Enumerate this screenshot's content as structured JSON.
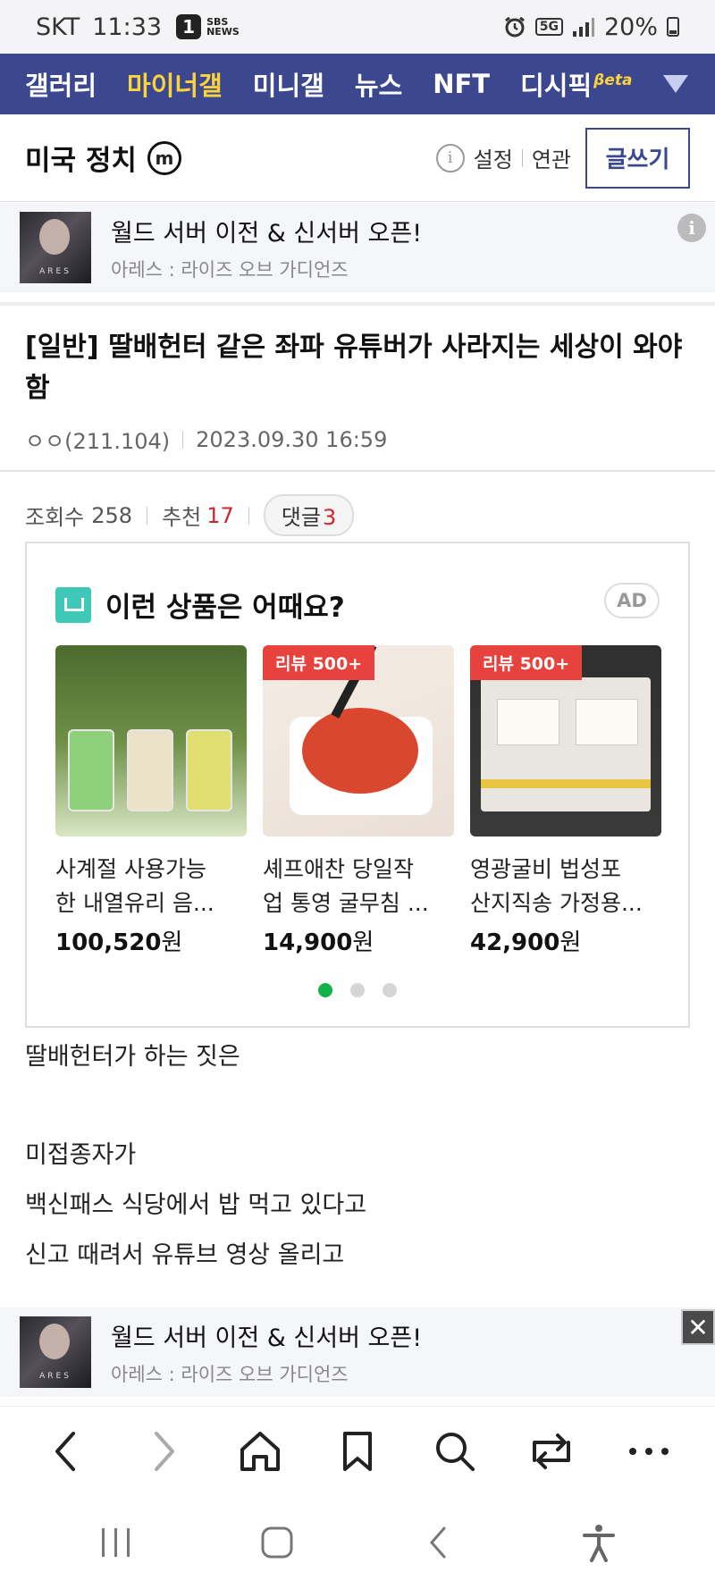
{
  "status_bar": {
    "carrier": "SKT",
    "time": "11:33",
    "notif_badge": "1",
    "sbs_line1": "SBS",
    "sbs_line2": "NEWS",
    "network": "5G",
    "battery": "20%"
  },
  "gallery_nav": {
    "tabs": [
      "갤러리",
      "마이너갤",
      "미니갤",
      "뉴스",
      "NFT",
      "디시픽"
    ],
    "active_index": 1,
    "beta_label": "βeta"
  },
  "board": {
    "title": "미국 정치",
    "minor_mark": "m",
    "links": [
      "설정",
      "연관"
    ],
    "write_button": "글쓰기"
  },
  "top_ad": {
    "title": "월드 서버 이전 & 신서버 오픈!",
    "subtitle": "아레스 : 라이즈 오브 가디언즈",
    "thumb_text": "ARES"
  },
  "post": {
    "title": "[일반] 딸배헌터 같은 좌파 유튜버가 사라지는 세상이 와야함",
    "author": "ㅇㅇ(211.104)",
    "date": "2023.09.30 16:59"
  },
  "stats": {
    "views_label": "조회수",
    "views": "258",
    "recommend_label": "추천",
    "recommend": "17",
    "comments_label": "댓글",
    "comments": "3"
  },
  "product_ad": {
    "heading": "이런 상품은 어때요?",
    "ad_label": "AD",
    "products": [
      {
        "line1": "사계절 사용가능",
        "line2": "한 내열유리 음...",
        "price": "100,520",
        "unit": "원",
        "badge": ""
      },
      {
        "line1": "셰프애찬 당일작",
        "line2": "업 통영 굴무침 ...",
        "price": "14,900",
        "unit": "원",
        "badge": "리뷰 500+"
      },
      {
        "line1": "영광굴비 법성포",
        "line2": "산지직송 가정용...",
        "price": "42,900",
        "unit": "원",
        "badge": "리뷰 500+"
      }
    ],
    "page_count": 3,
    "active_page": 0
  },
  "body_lines": [
    "딸배헌터가 하는 짓은",
    "미접종자가",
    "백신패스 식당에서 밥 먹고 있다고",
    "신고 때려서 유튜브 영상 올리고"
  ],
  "bottom_ad": {
    "title": "월드 서버 이전 & 신서버 오픈!",
    "subtitle": "아레스 : 라이즈 오브 가디언즈",
    "thumb_text": "ARES"
  },
  "colors": {
    "nav_bg": "#3b4890",
    "nav_active": "#fdd33b",
    "accent_red": "#d0262b",
    "badge_red": "#e8423e",
    "dot_active": "#14b04a"
  },
  "icons": {
    "browser_bar": [
      "back-icon",
      "forward-icon",
      "home-icon",
      "bookmark-icon",
      "search-icon",
      "tabs-icon",
      "more-icon"
    ],
    "system_nav": [
      "recents-icon",
      "home-button-icon",
      "system-back-icon",
      "accessibility-icon"
    ]
  }
}
